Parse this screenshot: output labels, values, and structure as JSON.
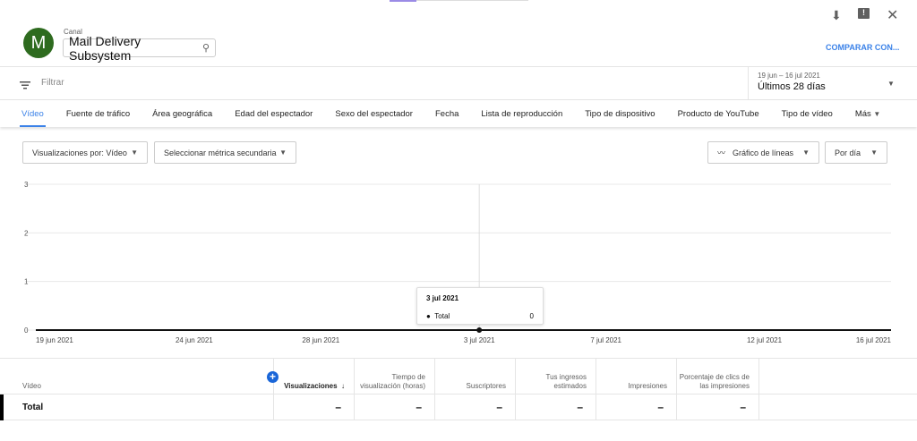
{
  "header": {
    "canal_label": "Canal",
    "avatar_letter": "M",
    "channel_name": "Mail Delivery Subsystem",
    "compare_label": "COMPARAR CON..."
  },
  "filter": {
    "placeholder": "Filtrar"
  },
  "date_range": {
    "range": "19 jun – 16 jul 2021",
    "label": "Últimos 28 días"
  },
  "tabs": [
    "Vídeo",
    "Fuente de tráfico",
    "Área geográfica",
    "Edad del espectador",
    "Sexo del espectador",
    "Fecha",
    "Lista de reproducción",
    "Tipo de dispositivo",
    "Producto de YouTube",
    "Tipo de vídeo",
    "Más"
  ],
  "controls": {
    "metric": "Visualizaciones por: Vídeo",
    "secondary": "Seleccionar métrica secundaria",
    "chart_type": "Gráfico de líneas",
    "granularity": "Por día"
  },
  "chart_data": {
    "type": "line",
    "x": [
      "19 jun",
      "20 jun",
      "21 jun",
      "22 jun",
      "23 jun",
      "24 jun",
      "25 jun",
      "26 jun",
      "27 jun",
      "28 jun",
      "29 jun",
      "30 jun",
      "1 jul",
      "2 jul",
      "3 jul",
      "4 jul",
      "5 jul",
      "6 jul",
      "7 jul",
      "8 jul",
      "9 jul",
      "10 jul",
      "11 jul",
      "12 jul",
      "13 jul",
      "14 jul",
      "15 jul",
      "16 jul"
    ],
    "series": [
      {
        "name": "Total",
        "values": [
          0,
          0,
          0,
          0,
          0,
          0,
          0,
          0,
          0,
          0,
          0,
          0,
          0,
          0,
          0,
          0,
          0,
          0,
          0,
          0,
          0,
          0,
          0,
          0,
          0,
          0,
          0,
          0
        ]
      }
    ],
    "ylim": [
      0,
      3
    ],
    "yticks": [
      "0",
      "1",
      "2",
      "3"
    ],
    "xticks": [
      {
        "i": 0,
        "label": "19 jun 2021"
      },
      {
        "i": 5,
        "label": "24 jun 2021"
      },
      {
        "i": 9,
        "label": "28 jun 2021"
      },
      {
        "i": 14,
        "label": "3 jul 2021"
      },
      {
        "i": 18,
        "label": "7 jul 2021"
      },
      {
        "i": 23,
        "label": "12 jul 2021"
      },
      {
        "i": 27,
        "label": "16 jul 2021"
      }
    ],
    "tooltip": {
      "i": 14,
      "title": "3 jul 2021",
      "series": "Total",
      "value": "0"
    }
  },
  "table": {
    "columns": [
      "Vídeo",
      "Visualizaciones",
      "Tiempo de visualización (horas)",
      "Suscriptores",
      "Tus ingresos estimados",
      "Impresiones",
      "Porcentaje de clics de las impresiones"
    ],
    "total_row": {
      "label": "Total",
      "values": [
        "–",
        "–",
        "–",
        "–",
        "–",
        "–"
      ]
    }
  }
}
